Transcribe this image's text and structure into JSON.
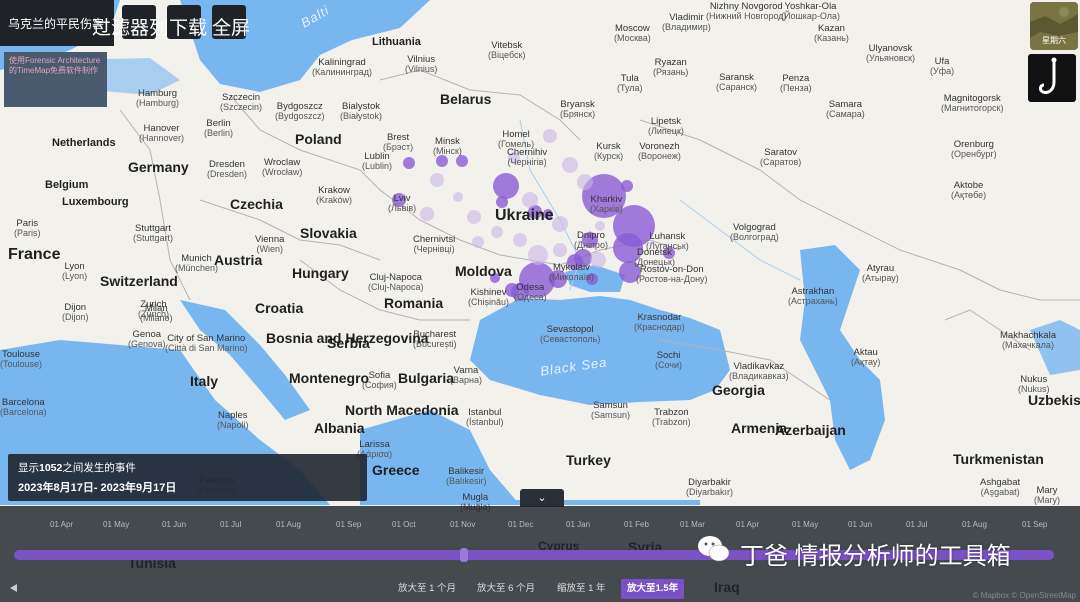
{
  "app": {
    "title": "乌克兰的平民伤害",
    "credit": "使用Forensic Architecture的TimeMap免费软件制作",
    "tools": {
      "filter": "过滤器",
      "list": "列",
      "download": "下载",
      "fullscreen": "全屏"
    },
    "thumbnail_label": "星期六",
    "help_icon": "question-mark-icon"
  },
  "info": {
    "count_prefix": "显示",
    "count": "1052",
    "count_suffix": "之间发生的事件",
    "range": "2023年8月17日- 2023年9月17日"
  },
  "timeline": {
    "ticks": [
      "01 Apr",
      "01 May",
      "01 Jun",
      "01 Jul",
      "01 Aug",
      "01 Sep",
      "01 Oct",
      "01 Nov",
      "01 Dec",
      "01 Jan",
      "01 Feb",
      "01 Mar",
      "01 Apr",
      "01 May",
      "01 Jun",
      "01 Jul",
      "01 Aug",
      "01 Sep"
    ],
    "zoom": [
      "放大至 1 个月",
      "放大至 6 个月",
      "缩放至 1 年",
      "放大至1.5年"
    ],
    "active_zoom": "放大至1.5年",
    "track_color": "#7b52c6"
  },
  "map": {
    "countries": [
      "Belarus",
      "Poland",
      "Germany",
      "Netherlands",
      "Belgium",
      "Luxembourg",
      "France",
      "Czechia",
      "Slovakia",
      "Austria",
      "Hungary",
      "Switzerland",
      "Ukraine",
      "Moldova",
      "Romania",
      "Croatia",
      "Bosnia and Herzegovina",
      "Serbia",
      "Montenegro",
      "Italy",
      "Bulgaria",
      "North Macedonia",
      "Albania",
      "Greece",
      "Turkey",
      "Georgia",
      "Armenia",
      "Azerbaijan",
      "Lithuania",
      "Turkmenistan",
      "Uzbekis",
      "Cyprus",
      "Syria",
      "Iraq",
      "Tunisia"
    ],
    "cities": [
      {
        "n": "Moscow",
        "r": "(Москва)"
      },
      {
        "n": "Vladimir",
        "r": "(Владимир)"
      },
      {
        "n": "Nizhny Novgorod",
        "r": "(Нижний Новгород)"
      },
      {
        "n": "Yoshkar-Ola",
        "r": "(Йошкар-Ола)"
      },
      {
        "n": "Kazan",
        "r": "(Казань)"
      },
      {
        "n": "Ulyanovsk",
        "r": "(Ульяновск)"
      },
      {
        "n": "Ufa",
        "r": "(Уфа)"
      },
      {
        "n": "Ryazan",
        "r": "(Рязань)"
      },
      {
        "n": "Tula",
        "r": "(Тула)"
      },
      {
        "n": "Saransk",
        "r": "(Саранск)"
      },
      {
        "n": "Penza",
        "r": "(Пенза)"
      },
      {
        "n": "Samara",
        "r": "(Самара)"
      },
      {
        "n": "Magnitogorsk",
        "r": "(Магнитогорск)"
      },
      {
        "n": "Orenburg",
        "r": "(Оренбург)"
      },
      {
        "n": "Aktobe",
        "r": "(Ақтөбе)"
      },
      {
        "n": "Lipetsk",
        "r": "(Липецк)"
      },
      {
        "n": "Kursk",
        "r": "(Курск)"
      },
      {
        "n": "Voronezh",
        "r": "(Воронеж)"
      },
      {
        "n": "Saratov",
        "r": "(Саратов)"
      },
      {
        "n": "Bryansk",
        "r": "(Брянск)"
      },
      {
        "n": "Vitebsk",
        "r": "(Віцебск)"
      },
      {
        "n": "Vilnius",
        "r": "(Vilnius)"
      },
      {
        "n": "Kaliningrad",
        "r": "(Калининград)"
      },
      {
        "n": "Hamburg",
        "r": "(Hamburg)"
      },
      {
        "n": "Szczecin",
        "r": "(Szczecin)"
      },
      {
        "n": "Bydgoszcz",
        "r": "(Bydgoszcz)"
      },
      {
        "n": "Bialystok",
        "r": "(Białystok)"
      },
      {
        "n": "Minsk",
        "r": "(Мінск)"
      },
      {
        "n": "Hanover",
        "r": "(Hannover)"
      },
      {
        "n": "Berlin",
        "r": "(Berlin)"
      },
      {
        "n": "Brest",
        "r": "(Брэст)"
      },
      {
        "n": "Homel",
        "r": "(Гомель)"
      },
      {
        "n": "Chernihiv",
        "r": "(Чернігів)"
      },
      {
        "n": "Lublin",
        "r": "(Lublin)"
      },
      {
        "n": "Dresden",
        "r": "(Dresden)"
      },
      {
        "n": "Wroclaw",
        "r": "(Wrocław)"
      },
      {
        "n": "Krakow",
        "r": "(Kraków)"
      },
      {
        "n": "Lviv",
        "r": "(Львів)"
      },
      {
        "n": "Kharkiv",
        "r": "(Харків)"
      },
      {
        "n": "Luhansk",
        "r": "(Луганськ)"
      },
      {
        "n": "Dnipro",
        "r": "(Дніпро)"
      },
      {
        "n": "Donetsk",
        "r": "(Донецьк)"
      },
      {
        "n": "Rostov-on-Don",
        "r": "(Ростов-на-Дону)"
      },
      {
        "n": "Volgograd",
        "r": "(Волгоград)"
      },
      {
        "n": "Atyrau",
        "r": "(Атырау)"
      },
      {
        "n": "Astrakhan",
        "r": "(Астрахань)"
      },
      {
        "n": "Krasnodar",
        "r": "(Краснодар)"
      },
      {
        "n": "Sevastopol",
        "r": "(Севастополь)"
      },
      {
        "n": "Sochi",
        "r": "(Сочи)"
      },
      {
        "n": "Makhachkala",
        "r": "(Махачкала)"
      },
      {
        "n": "Vladikavkaz",
        "r": "(Владикавказ)"
      },
      {
        "n": "Aktau",
        "r": "(Ақтау)"
      },
      {
        "n": "Nukus",
        "r": "(Nukus)"
      },
      {
        "n": "Trabzon",
        "r": "(Trabzon)"
      },
      {
        "n": "Samsun",
        "r": "(Samsun)"
      },
      {
        "n": "Istanbul",
        "r": "(İstanbul)"
      },
      {
        "n": "Balikesir",
        "r": "(Balıkesir)"
      },
      {
        "n": "Diyarbakir",
        "r": "(Diyarbakır)"
      },
      {
        "n": "Mugla",
        "r": "(Muğla)"
      },
      {
        "n": "Ashgabat",
        "r": "(Aşgabat)"
      },
      {
        "n": "Mary",
        "r": "(Mary)"
      },
      {
        "n": "Kishinev",
        "r": "(Chișinău)"
      },
      {
        "n": "Odesa",
        "r": "(Одеса)"
      },
      {
        "n": "Mykolaiv",
        "r": "(Миколаїв)"
      },
      {
        "n": "Chernivtsi",
        "r": "(Чернівці)"
      },
      {
        "n": "Cluj-Napoca",
        "r": "(Cluj-Napoca)"
      },
      {
        "n": "Bucharest",
        "r": "(București)"
      },
      {
        "n": "Varna",
        "r": "(Варна)"
      },
      {
        "n": "Sofia",
        "r": "(София)"
      },
      {
        "n": "Vienna",
        "r": "(Wien)"
      },
      {
        "n": "Stuttgart",
        "r": "(Stuttgart)"
      },
      {
        "n": "Munich",
        "r": "(München)"
      },
      {
        "n": "Zurich",
        "r": "(Zürich)"
      },
      {
        "n": "Milan",
        "r": "(Milano)"
      },
      {
        "n": "Genoa",
        "r": "(Genova)"
      },
      {
        "n": "Lyon",
        "r": "(Lyon)"
      },
      {
        "n": "Dijon",
        "r": "(Dijon)"
      },
      {
        "n": "Paris",
        "r": "(Paris)"
      },
      {
        "n": "Toulouse",
        "r": "(Toulouse)"
      },
      {
        "n": "Barcelona",
        "r": "(Barcelona)"
      },
      {
        "n": "Naples",
        "r": "(Napoli)"
      },
      {
        "n": "Palermo",
        "r": "(Palermo)"
      },
      {
        "n": "Larissa",
        "r": "(Λάρισα)"
      },
      {
        "n": "City of San Marino",
        "r": "(Città di San Marino)"
      }
    ],
    "sea_labels": [
      "Black Sea",
      "Balti"
    ],
    "attribution": "© Mapbox © OpenStreetMap"
  },
  "watermark": {
    "text": "丁爸 情报分析师的工具箱",
    "icon": "wechat-icon"
  },
  "colors": {
    "marker": "#8a5cd6",
    "marker_light": "#c9b6e6",
    "water": "#78b6f0",
    "panel": "#1f2227"
  }
}
